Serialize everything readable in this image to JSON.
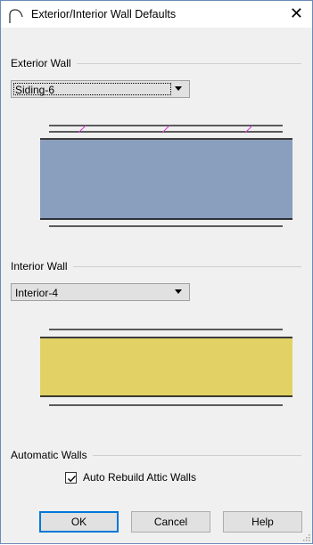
{
  "window": {
    "title": "Exterior/Interior Wall Defaults",
    "close_glyph": "✕"
  },
  "exterior": {
    "group_label": "Exterior Wall",
    "selected": "Siding-6",
    "fill_color": "#8a9ebd",
    "hatch_color": "#d63ad6"
  },
  "interior": {
    "group_label": "Interior Wall",
    "selected": "Interior-4",
    "fill_color": "#e2d266"
  },
  "automatic": {
    "group_label": "Automatic Walls",
    "checkbox_label": "Auto Rebuild Attic Walls",
    "checked": true
  },
  "buttons": {
    "ok": "OK",
    "cancel": "Cancel",
    "help": "Help"
  },
  "icons": {
    "app": "curved-wall-icon",
    "close": "close-icon",
    "dropdown": "chevron-down-icon",
    "check": "checkmark-icon"
  }
}
